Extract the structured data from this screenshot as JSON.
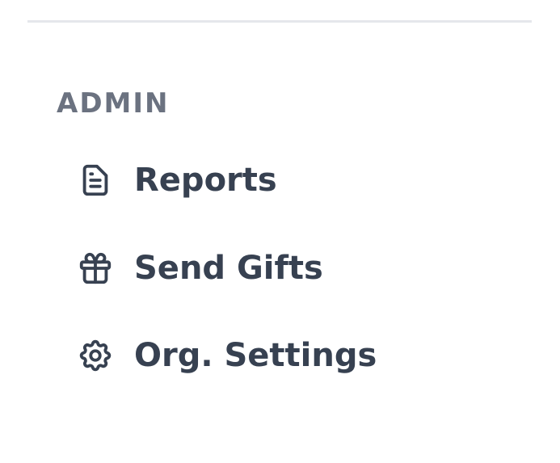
{
  "admin_section": {
    "heading": "ADMIN",
    "items": [
      {
        "label": "Reports",
        "icon": "document-report-icon"
      },
      {
        "label": "Send Gifts",
        "icon": "gift-icon"
      },
      {
        "label": "Org. Settings",
        "icon": "cog-icon"
      }
    ]
  },
  "colors": {
    "heading": "#6b7280",
    "item_text": "#374151",
    "divider": "#e5e7eb"
  }
}
